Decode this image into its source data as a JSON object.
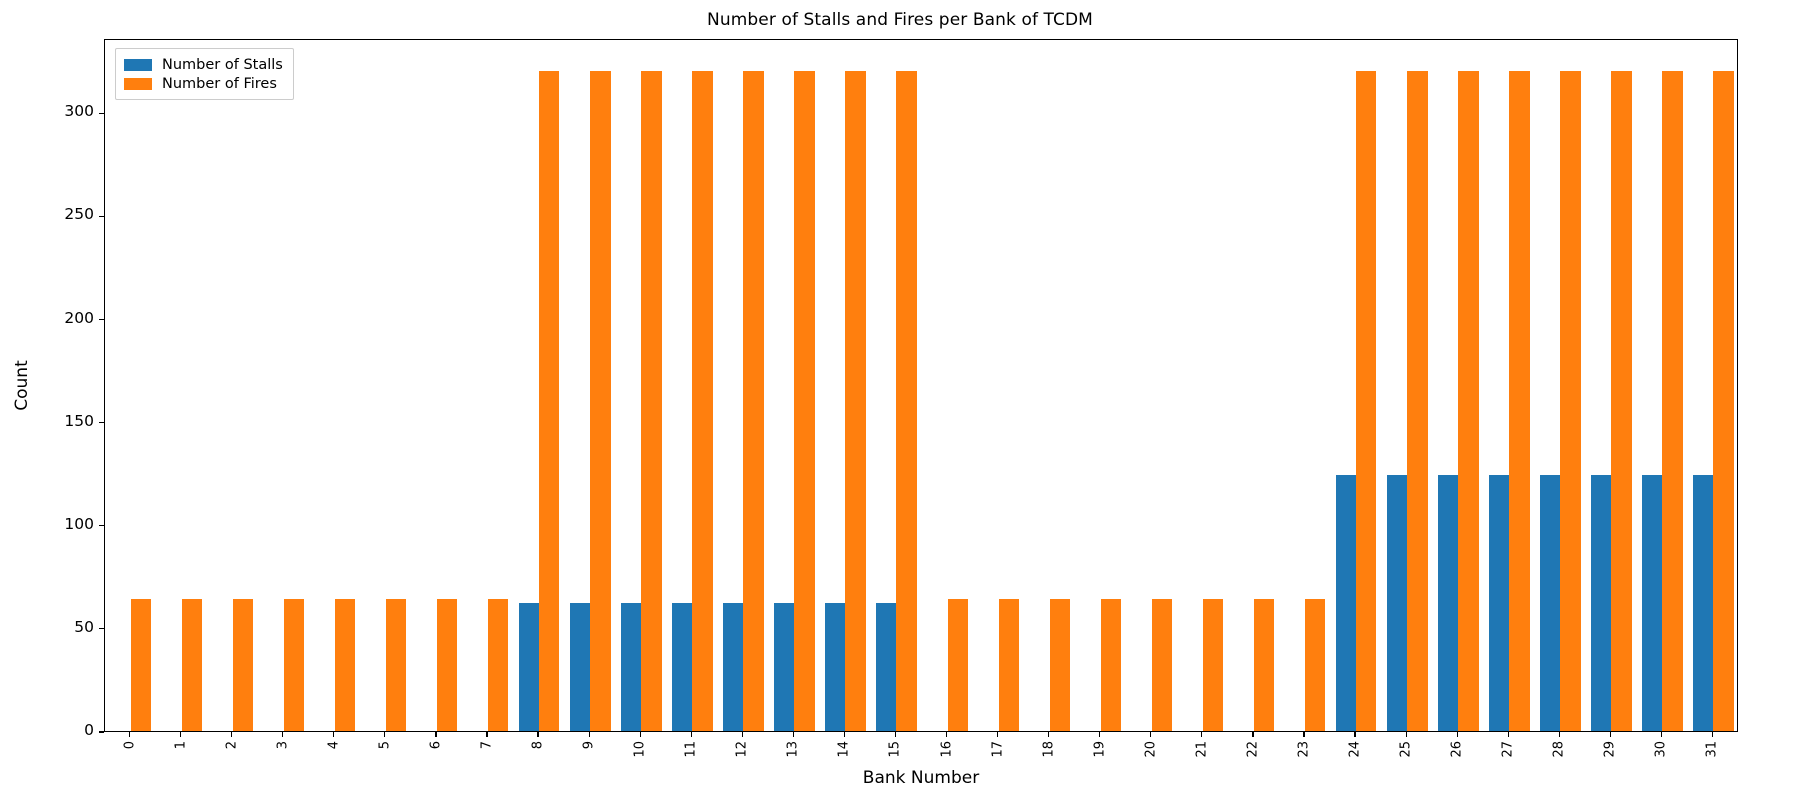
{
  "chart_data": {
    "type": "bar",
    "title": "Number of Stalls and Fires per Bank of TCDM",
    "xlabel": "Bank Number",
    "ylabel": "Count",
    "categories": [
      "0",
      "1",
      "2",
      "3",
      "4",
      "5",
      "6",
      "7",
      "8",
      "9",
      "10",
      "11",
      "12",
      "13",
      "14",
      "15",
      "16",
      "17",
      "18",
      "19",
      "20",
      "21",
      "22",
      "23",
      "24",
      "25",
      "26",
      "27",
      "28",
      "29",
      "30",
      "31"
    ],
    "series": [
      {
        "name": "Number of Stalls",
        "color": "#1f77b4",
        "values": [
          0,
          0,
          0,
          0,
          0,
          0,
          0,
          0,
          62,
          62,
          62,
          62,
          62,
          62,
          62,
          62,
          0,
          0,
          0,
          0,
          0,
          0,
          0,
          0,
          124,
          124,
          124,
          124,
          124,
          124,
          124,
          124
        ]
      },
      {
        "name": "Number of Fires",
        "color": "#ff7f0e",
        "values": [
          64,
          64,
          64,
          64,
          64,
          64,
          64,
          64,
          320,
          320,
          320,
          320,
          320,
          320,
          320,
          320,
          64,
          64,
          64,
          64,
          64,
          64,
          64,
          64,
          320,
          320,
          320,
          320,
          320,
          320,
          320,
          320
        ]
      }
    ],
    "ylim": [
      0,
      336
    ],
    "yticks": [
      0,
      50,
      100,
      150,
      200,
      250,
      300
    ],
    "ytick_labels": [
      "0",
      "50",
      "100",
      "150",
      "200",
      "250",
      "300"
    ],
    "grid": false,
    "legend_position": "upper left",
    "xtick_rotation": 90
  }
}
